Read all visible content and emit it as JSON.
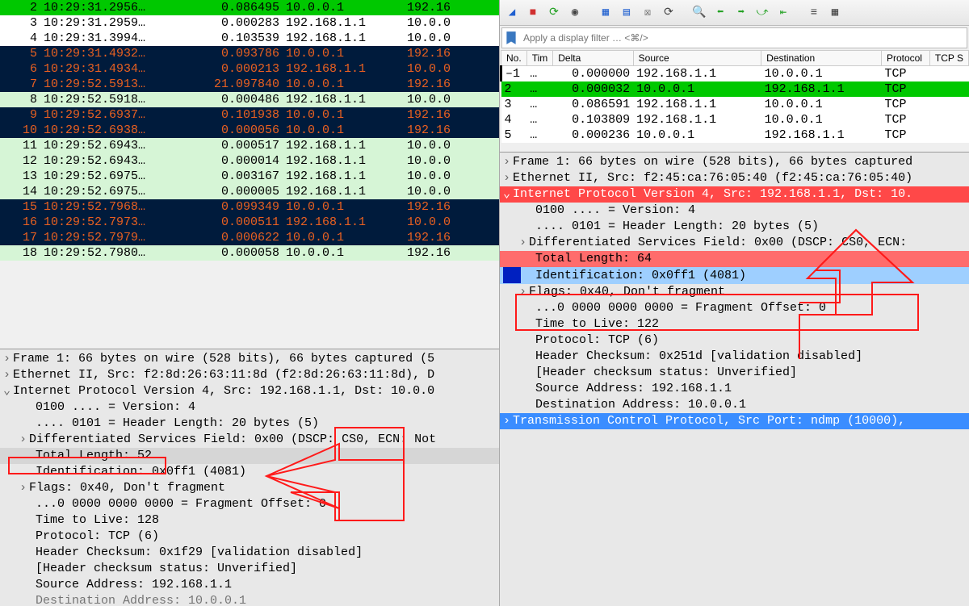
{
  "left": {
    "packets": [
      {
        "no": "2",
        "time": "10:29:31.2956…",
        "delta": "0.086495",
        "src": "10.0.0.1",
        "dst": "192.16",
        "cls": "row-green"
      },
      {
        "no": "3",
        "time": "10:29:31.2959…",
        "delta": "0.000283",
        "src": "192.168.1.1",
        "dst": "10.0.0",
        "cls": "row-white"
      },
      {
        "no": "4",
        "time": "10:29:31.3994…",
        "delta": "0.103539",
        "src": "192.168.1.1",
        "dst": "10.0.0",
        "cls": "row-white"
      },
      {
        "no": "5",
        "time": "10:29:31.4932…",
        "delta": "0.093786",
        "src": "10.0.0.1",
        "dst": "192.16",
        "cls": "row-navy"
      },
      {
        "no": "6",
        "time": "10:29:31.4934…",
        "delta": "0.000213",
        "src": "192.168.1.1",
        "dst": "10.0.0",
        "cls": "row-navy"
      },
      {
        "no": "7",
        "time": "10:29:52.5913…",
        "delta": "21.097840",
        "src": "10.0.0.1",
        "dst": "192.16",
        "cls": "row-navy"
      },
      {
        "no": "8",
        "time": "10:29:52.5918…",
        "delta": "0.000486",
        "src": "192.168.1.1",
        "dst": "10.0.0",
        "cls": "row-greenlite"
      },
      {
        "no": "9",
        "time": "10:29:52.6937…",
        "delta": "0.101938",
        "src": "10.0.0.1",
        "dst": "192.16",
        "cls": "row-navy"
      },
      {
        "no": "10",
        "time": "10:29:52.6938…",
        "delta": "0.000056",
        "src": "10.0.0.1",
        "dst": "192.16",
        "cls": "row-navy"
      },
      {
        "no": "11",
        "time": "10:29:52.6943…",
        "delta": "0.000517",
        "src": "192.168.1.1",
        "dst": "10.0.0",
        "cls": "row-greenlite"
      },
      {
        "no": "12",
        "time": "10:29:52.6943…",
        "delta": "0.000014",
        "src": "192.168.1.1",
        "dst": "10.0.0",
        "cls": "row-greenlite"
      },
      {
        "no": "13",
        "time": "10:29:52.6975…",
        "delta": "0.003167",
        "src": "192.168.1.1",
        "dst": "10.0.0",
        "cls": "row-greenlite"
      },
      {
        "no": "14",
        "time": "10:29:52.6975…",
        "delta": "0.000005",
        "src": "192.168.1.1",
        "dst": "10.0.0",
        "cls": "row-greenlite"
      },
      {
        "no": "15",
        "time": "10:29:52.7968…",
        "delta": "0.099349",
        "src": "10.0.0.1",
        "dst": "192.16",
        "cls": "row-navy"
      },
      {
        "no": "16",
        "time": "10:29:52.7973…",
        "delta": "0.000511",
        "src": "192.168.1.1",
        "dst": "10.0.0",
        "cls": "row-navy"
      },
      {
        "no": "17",
        "time": "10:29:52.7979…",
        "delta": "0.000622",
        "src": "10.0.0.1",
        "dst": "192.16",
        "cls": "row-navy"
      },
      {
        "no": "18",
        "time": "10:29:52.7980…",
        "delta": "0.000058",
        "src": "10.0.0.1",
        "dst": "192.16",
        "cls": "row-greenlite"
      }
    ],
    "details": {
      "frame": "Frame 1: 66 bytes on wire (528 bits), 66 bytes captured (5",
      "eth": "Ethernet II, Src: f2:8d:26:63:11:8d (f2:8d:26:63:11:8d), D",
      "ipv4": "Internet Protocol Version 4, Src: 192.168.1.1, Dst: 10.0.0",
      "version": "0100 .... = Version: 4",
      "hdrlen": ".... 0101 = Header Length: 20 bytes (5)",
      "dsf": "Differentiated Services Field: 0x00 (DSCP: CS0, ECN: Not",
      "totlen": "Total Length: 52",
      "ident": "Identification: 0x0ff1 (4081)",
      "flags": "Flags: 0x40, Don't fragment",
      "fragoff": "...0 0000 0000 0000 = Fragment Offset: 0",
      "ttl": "Time to Live: 128",
      "proto": "Protocol: TCP (6)",
      "chksum": "Header Checksum: 0x1f29 [validation disabled]",
      "chkstat": "[Header checksum status: Unverified]",
      "srcaddr": "Source Address: 192.168.1.1",
      "dstaddr": "Destination Address: 10.0.0.1"
    }
  },
  "right": {
    "filter_placeholder": "Apply a display filter … <⌘/>",
    "headers": {
      "no": "No.",
      "time": "Tim",
      "delta": "Delta",
      "src": "Source",
      "dst": "Destination",
      "proto": "Protocol",
      "tcps": "TCP S"
    },
    "packets": [
      {
        "no": "1",
        "time": "…",
        "delta": "0.000000",
        "src": "192.168.1.1",
        "dst": "10.0.0.1",
        "proto": "TCP",
        "cls": "row-white"
      },
      {
        "no": "2",
        "time": "…",
        "delta": "0.000032",
        "src": "10.0.0.1",
        "dst": "192.168.1.1",
        "proto": "TCP",
        "cls": "row-green"
      },
      {
        "no": "3",
        "time": "…",
        "delta": "0.086591",
        "src": "192.168.1.1",
        "dst": "10.0.0.1",
        "proto": "TCP",
        "cls": "row-white"
      },
      {
        "no": "4",
        "time": "…",
        "delta": "0.103809",
        "src": "192.168.1.1",
        "dst": "10.0.0.1",
        "proto": "TCP",
        "cls": "row-white"
      },
      {
        "no": "5",
        "time": "…",
        "delta": "0.000236",
        "src": "10.0.0.1",
        "dst": "192.168.1.1",
        "proto": "TCP",
        "cls": "row-white"
      }
    ],
    "details": {
      "frame": "Frame 1: 66 bytes on wire (528 bits), 66 bytes captured",
      "eth": "Ethernet II, Src: f2:45:ca:76:05:40 (f2:45:ca:76:05:40)",
      "ipv4": "Internet Protocol Version 4, Src: 192.168.1.1, Dst: 10.",
      "version": "0100 .... = Version: 4",
      "hdrlen": ".... 0101 = Header Length: 20 bytes (5)",
      "dsf": "Differentiated Services Field: 0x00 (DSCP: CS0, ECN: ",
      "totlen": "Total Length: 64",
      "ident": "Identification: 0x0ff1 (4081)",
      "flags": "Flags: 0x40, Don't fragment",
      "fragoff": "...0 0000 0000 0000 = Fragment Offset: 0",
      "ttl": "Time to Live: 122",
      "proto": "Protocol: TCP (6)",
      "chksum": "Header Checksum: 0x251d [validation disabled]",
      "chkstat": "[Header checksum status: Unverified]",
      "srcaddr": "Source Address: 192.168.1.1",
      "dstaddr": "Destination Address: 10.0.0.1",
      "tcp": "Transmission Control Protocol, Src Port: ndmp (10000),"
    }
  }
}
